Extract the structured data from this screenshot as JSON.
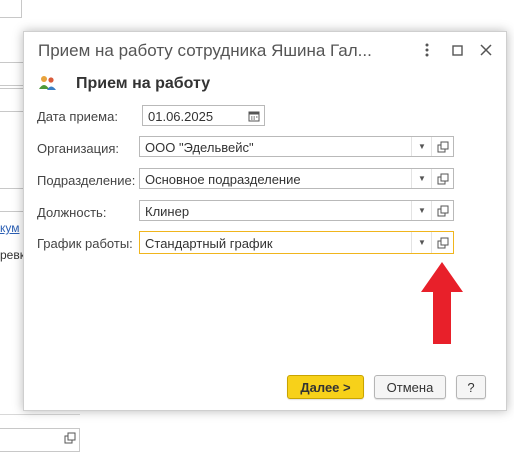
{
  "background": {
    "link_fragment": "кум",
    "text_fragment": "ревк"
  },
  "dialog": {
    "window_title": "Прием на работу сотрудника Яшина Гал...",
    "header": "Прием на работу",
    "fields": {
      "hire_date": {
        "label": "Дата приема:",
        "value": "01.06.2025"
      },
      "organization": {
        "label": "Организация:",
        "value": "ООО \"Эдельвейс\""
      },
      "department": {
        "label": "Подразделение:",
        "value": "Основное подразделение"
      },
      "position": {
        "label": "Должность:",
        "value": "Клинер"
      },
      "schedule": {
        "label": "График работы:",
        "value": "Стандартный график"
      }
    },
    "buttons": {
      "next": "Далее >",
      "cancel": "Отмена",
      "help": "?"
    }
  },
  "annotation": {
    "arrow_color": "#e8202a"
  },
  "colors": {
    "accent": "#f7d11a",
    "focus_border": "#f0b51d"
  }
}
